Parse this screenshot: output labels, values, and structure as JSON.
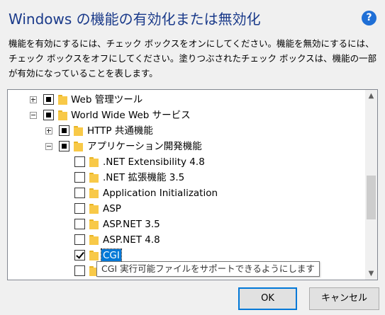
{
  "dialog": {
    "title": "Windows の機能の有効化または無効化",
    "help_icon": "?",
    "description": "機能を有効にするには、チェック ボックスをオンにしてください。機能を無効にするには、チェック ボックスをオフにしてください。塗りつぶされたチェック ボックスは、機能の一部が有効になっていることを表します。"
  },
  "tree": {
    "items": [
      {
        "label": "Web 管理ツール",
        "state": "partial",
        "expander": "plus"
      },
      {
        "label": "World Wide Web サービス",
        "state": "partial",
        "expander": "minus"
      },
      {
        "label": "HTTP 共通機能",
        "state": "partial",
        "expander": "plus"
      },
      {
        "label": "アプリケーション開発機能",
        "state": "partial",
        "expander": "minus"
      },
      {
        "label": ".NET Extensibility 4.8",
        "state": "unchecked"
      },
      {
        "label": ".NET 拡張機能 3.5",
        "state": "unchecked"
      },
      {
        "label": "Application Initialization",
        "state": "unchecked"
      },
      {
        "label": "ASP",
        "state": "unchecked"
      },
      {
        "label": "ASP.NET 3.5",
        "state": "unchecked"
      },
      {
        "label": "ASP.NET 4.8",
        "state": "unchecked"
      },
      {
        "label": "CGI",
        "state": "checked",
        "selected": true
      },
      {
        "label": "",
        "state": "unchecked"
      },
      {
        "label": "",
        "state": "unchecked"
      }
    ]
  },
  "tooltip": "CGI 実行可能ファイルをサポートできるようにします",
  "scrollbar": {
    "up": "▲",
    "down": "▼"
  },
  "buttons": {
    "ok": "OK",
    "cancel": "キャンセル"
  }
}
